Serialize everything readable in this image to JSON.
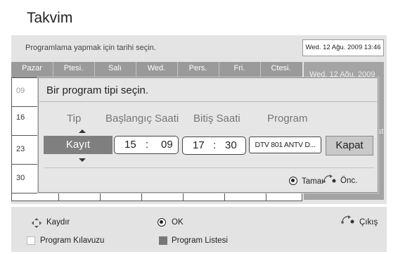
{
  "header": {
    "title": "Takvim"
  },
  "calendar": {
    "instruction": "Programlama yapmak için tarihi seçin.",
    "current_datetime": "Wed. 12 Ağu. 2009 13:46",
    "day_names": [
      "Pazar",
      "Ptesi.",
      "Salı",
      "Wed.",
      "Pers.",
      "Fri.",
      "Ctesi."
    ],
    "row_numbers": [
      "09",
      "16",
      "23",
      "30"
    ],
    "side_text": "Wed. 12 Ağu. 2009",
    "side_text_partial": "st"
  },
  "dialog": {
    "title": "Bir program tipi seçin.",
    "columns": {
      "type": "Tip",
      "start_time": "Başlangıç Saati",
      "end_time": "Bitiş Saati",
      "program": "Program"
    },
    "type_value": "Kayıt",
    "start_time": {
      "hour": "15",
      "sep": ":",
      "minute": "09"
    },
    "end_time": {
      "hour": "17",
      "sep": ":",
      "minute": "30"
    },
    "program_value": "DTV 801 ANTV D...",
    "close_label": "Kapat",
    "ok_label": "Tamam",
    "back_label": "Önc."
  },
  "footer": {
    "move_label": "Kaydır",
    "ok_label": "OK",
    "exit_label": "Çıkış",
    "guide_label": "Program Kılavuzu",
    "list_label": "Program Listesi"
  },
  "icons": {
    "move": "four-way-arrow-icon",
    "ok": "ok-radio-icon",
    "back": "return-arrow-icon",
    "guide_key": "white-key-icon",
    "list_key": "gray-key-icon"
  },
  "colors": {
    "panel_bg": "#e4e4e4",
    "calendar_header": "#9a9a9a",
    "selected_type": "#7f7f7f",
    "dialog_bg": "#e6e6e6",
    "side_panel": "#a4a4a4"
  }
}
